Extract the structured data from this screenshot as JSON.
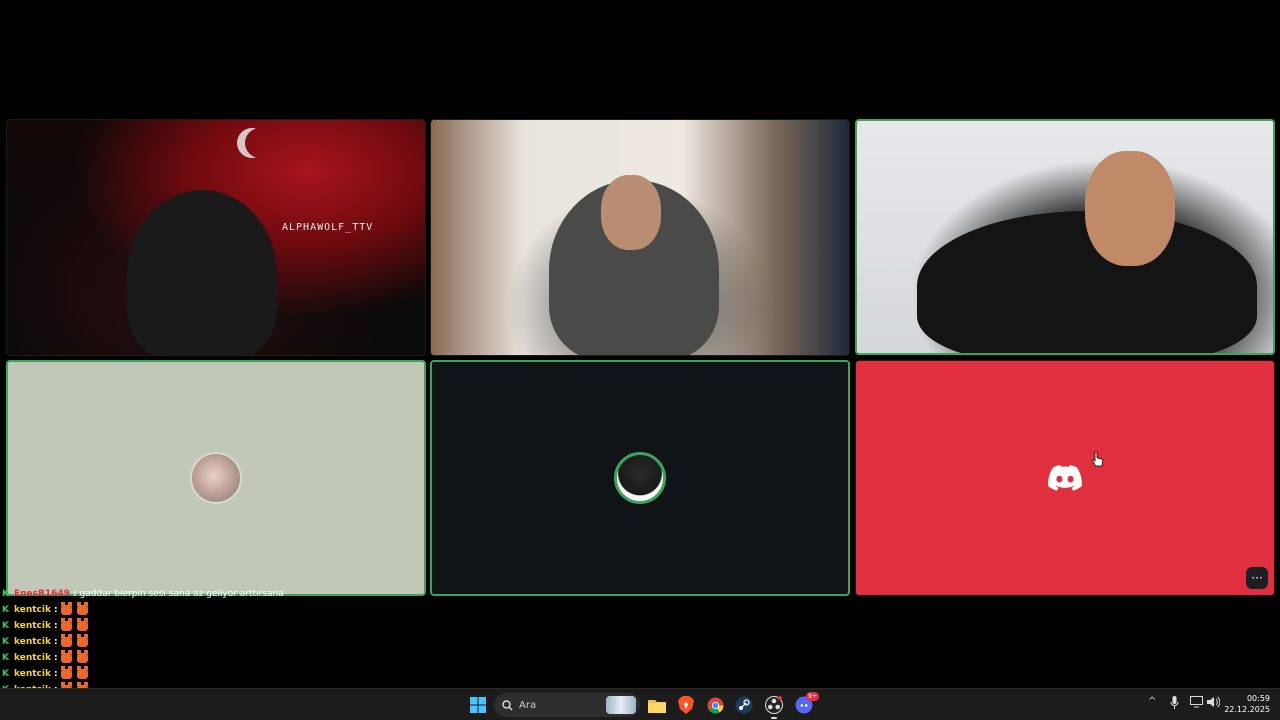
{
  "tiles": [
    {
      "id": 1,
      "kind": "video",
      "speaking": false,
      "overlay_text": "ALPHAWOLF_TTV"
    },
    {
      "id": 2,
      "kind": "video",
      "speaking": false
    },
    {
      "id": 3,
      "kind": "video",
      "speaking": true
    },
    {
      "id": 4,
      "kind": "avatar",
      "speaking": true
    },
    {
      "id": 5,
      "kind": "avatar",
      "speaking": true
    },
    {
      "id": 6,
      "kind": "screen",
      "speaking": false,
      "icon": "discord-icon",
      "more_label": "···"
    }
  ],
  "colors": {
    "speaking_border": "#3ba55d",
    "discord_red": "#e0303f",
    "tile4_bg": "#c1c8b8",
    "tile5_bg": "#101417",
    "taskbar_bg": "#1c1c1c",
    "chat_user": "#f5d34a"
  },
  "chat": {
    "messages": [
      {
        "user": "EnesB1649",
        "separator": ":",
        "text": "gaddar bierpin sesi sana az geliyor arttırsana",
        "emotes": 0,
        "user_style": "red"
      },
      {
        "user": "kentcik",
        "separator": ":",
        "text": "",
        "emotes": 2
      },
      {
        "user": "kentcik",
        "separator": ":",
        "text": "",
        "emotes": 2
      },
      {
        "user": "kentcik",
        "separator": ":",
        "text": "",
        "emotes": 2
      },
      {
        "user": "kentcik",
        "separator": ":",
        "text": "",
        "emotes": 2
      },
      {
        "user": "kentcik",
        "separator": ":",
        "text": "",
        "emotes": 2
      },
      {
        "user": "kentcik",
        "separator": ":",
        "text": "",
        "emotes": 2
      }
    ]
  },
  "taskbar": {
    "search_placeholder": "Ara",
    "apps": [
      "windows-start-icon",
      "search",
      "file-explorer-icon",
      "brave-icon",
      "chrome-icon",
      "steam-icon",
      "obs-icon",
      "discord-icon"
    ],
    "discord_badge": "9+",
    "tray_icons": [
      "chevron-up-icon",
      "microphone-icon",
      "display-icon",
      "speaker-icon"
    ],
    "time": "00:59",
    "date": "22.12.2025"
  }
}
